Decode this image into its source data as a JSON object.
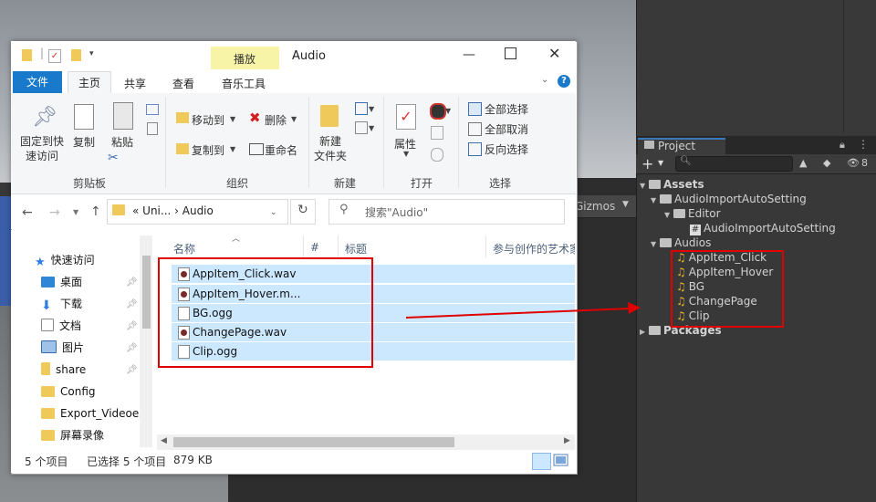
{
  "unity": {
    "gizmos_label": "Gizmos",
    "project_tab": "Project",
    "eye_count": "8",
    "tree": [
      {
        "label": "Assets",
        "bold": true
      },
      {
        "label": "AudioImportAutoSetting"
      },
      {
        "label": "Editor"
      },
      {
        "label": "AudioImportAutoSetting"
      },
      {
        "label": "Audios"
      },
      {
        "label": "AppItem_Click"
      },
      {
        "label": "AppItem_Hover"
      },
      {
        "label": "BG"
      },
      {
        "label": "ChangePage"
      },
      {
        "label": "Clip"
      },
      {
        "label": "Packages",
        "bold": true
      }
    ],
    "colors": {
      "audio_icon": "#e7b72b",
      "selection": "#cce8ff",
      "annotation": "#e00000"
    }
  },
  "explorer": {
    "title": "Audio",
    "context_tab": "播放",
    "ribbon_tabs": {
      "file": "文件",
      "home": "主页",
      "share": "共享",
      "view": "查看",
      "music_tools": "音乐工具"
    },
    "ribbon": {
      "pin_quick": "固定到快\n速访问",
      "copy": "复制",
      "paste": "粘贴",
      "move_to": "移动到",
      "copy_to": "复制到",
      "delete": "删除",
      "rename": "重命名",
      "new_folder": "新建\n文件夹",
      "properties": "属性",
      "select_all": "全部选择",
      "select_none": "全部取消",
      "invert_select": "反向选择",
      "groups": {
        "clipboard": "剪贴板",
        "organize": "组织",
        "new": "新建",
        "open": "打开",
        "select": "选择"
      }
    },
    "address": {
      "crumbs": "«  Uni...  ›  Audio",
      "search_placeholder": "搜索\"Audio\""
    },
    "nav": [
      {
        "label": "快速访问"
      },
      {
        "label": "桌面"
      },
      {
        "label": "下载"
      },
      {
        "label": "文档"
      },
      {
        "label": "图片"
      },
      {
        "label": "share"
      },
      {
        "label": "Config"
      },
      {
        "label": "Export_Videoes"
      },
      {
        "label": "屏幕录像"
      }
    ],
    "columns": {
      "name": "名称",
      "number": "#",
      "title": "标题",
      "artist": "参与创作的艺术家"
    },
    "files": [
      {
        "name": "AppItem_Click.wav"
      },
      {
        "name": "AppItem_Hover.m..."
      },
      {
        "name": "BG.ogg"
      },
      {
        "name": "ChangePage.wav"
      },
      {
        "name": "Clip.ogg"
      }
    ],
    "status": {
      "count": "5 个项目",
      "selected": "已选择 5 个项目",
      "size": "879 KB"
    }
  }
}
